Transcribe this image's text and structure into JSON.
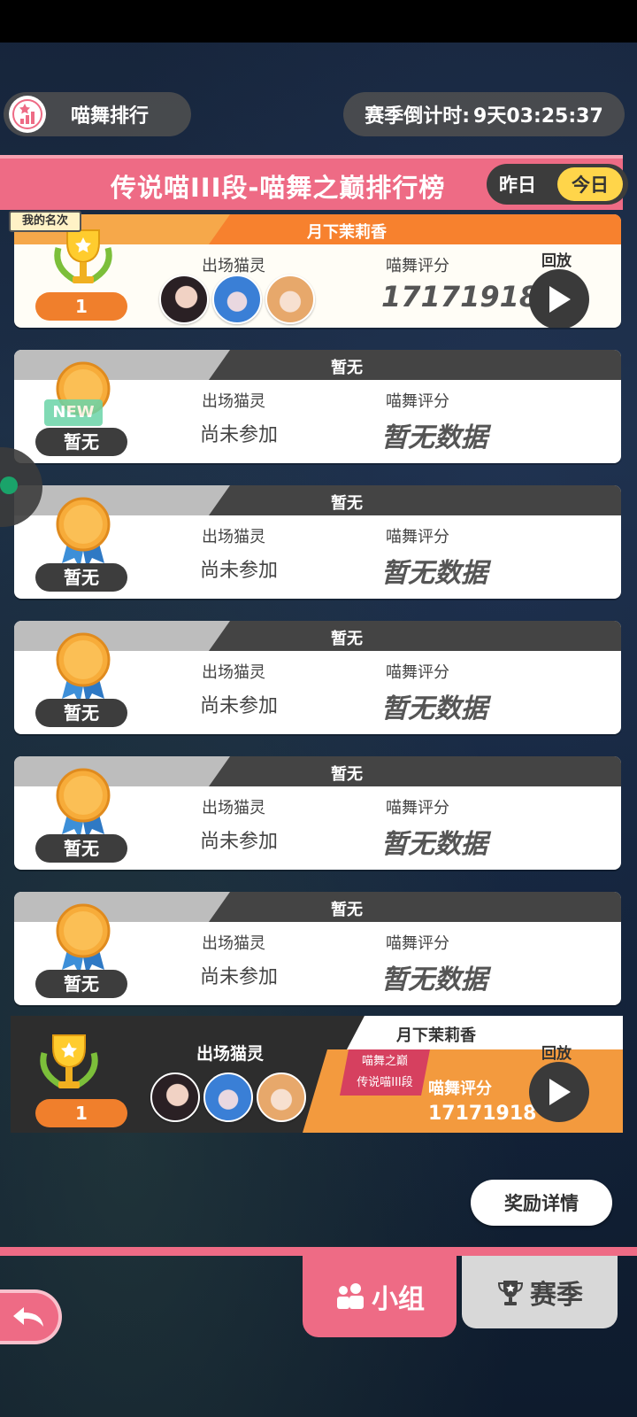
{
  "top": {
    "title": "喵舞排行",
    "countdown_label": "赛季倒计时:",
    "countdown_value": "9天03:25:37"
  },
  "banner": {
    "title": "传说喵III段-喵舞之巅排行榜",
    "yesterday": "昨日",
    "today": "今日"
  },
  "my_rank_badge": "我的名次",
  "labels": {
    "cats": "出场猫灵",
    "score": "喵舞评分",
    "replay": "回放"
  },
  "rows": [
    {
      "name": "月下茉莉香",
      "rank": "1",
      "score": "17171918"
    },
    {
      "name": "暂无",
      "rank": "暂无",
      "cats": "尚未参加",
      "score": "暂无数据",
      "new_tag": "NEW"
    },
    {
      "name": "暂无",
      "rank": "暂无",
      "cats": "尚未参加",
      "score": "暂无数据"
    },
    {
      "name": "暂无",
      "rank": "暂无",
      "cats": "尚未参加",
      "score": "暂无数据"
    },
    {
      "name": "暂无",
      "rank": "暂无",
      "cats": "尚未参加",
      "score": "暂无数据"
    },
    {
      "name": "暂无",
      "rank": "暂无",
      "cats": "尚未参加",
      "score": "暂无数据"
    }
  ],
  "own": {
    "name": "月下茉莉香",
    "rank": "1",
    "tag_line1": "喵舞之巅",
    "tag_line2": "传说喵III段",
    "score": "17171918"
  },
  "reward_button": "奖励详情",
  "tabs": {
    "group": "小组",
    "season": "赛季"
  },
  "colors": {
    "accent_pink": "#ee6b85",
    "gold": "#ffd54a",
    "orange": "#f7812e"
  }
}
